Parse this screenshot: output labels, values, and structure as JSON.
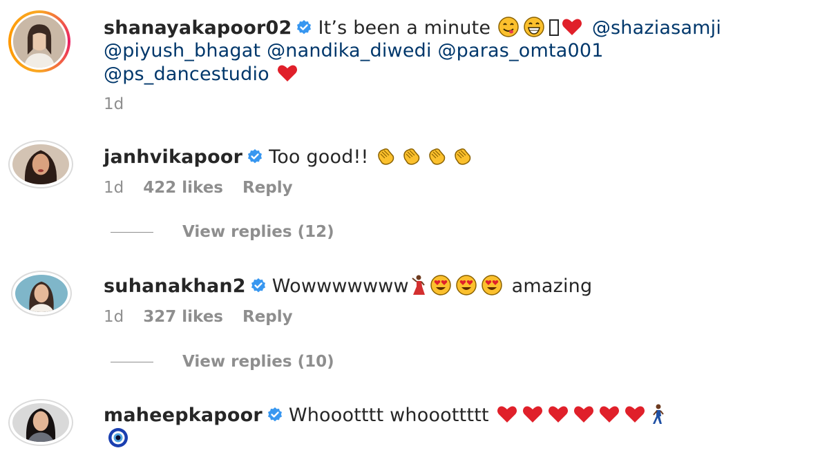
{
  "comments": [
    {
      "username": "shanayakapoor02",
      "text_before": "It’s been a minute",
      "mentions": [
        "@shaziasamji",
        "@piyush_bhagat",
        "@nandika_diwedi",
        "@paras_omta001",
        "@ps_dancestudio"
      ],
      "time": "1d"
    },
    {
      "username": "janhvikapoor",
      "text": "Too good!!",
      "time": "1d",
      "likes": "422 likes",
      "reply": "Reply",
      "view_replies": "View replies (12)"
    },
    {
      "username": "suhanakhan2",
      "text": "Wowwwwwww",
      "text_after": "amazing",
      "time": "1d",
      "likes": "327 likes",
      "reply": "Reply",
      "view_replies": "View replies (10)"
    },
    {
      "username": "maheepkapoor",
      "text": "Whoootttt whooottttt"
    }
  ],
  "colors": {
    "username": "#262626",
    "mention": "#00376b",
    "meta": "#8e8e8e",
    "verified": "#3897f0",
    "heart": "#e0202a"
  },
  "icons": {
    "verified": "verified-badge-icon",
    "heart": "red-heart-icon",
    "clap": "clapping-hands-icon",
    "heart_eyes": "heart-eyes-face-icon",
    "yum": "yum-face-icon",
    "grin": "grinning-face-icon",
    "dancer": "dancer-icon",
    "walker": "person-walking-icon",
    "evil_eye": "nazar-amulet-icon"
  }
}
